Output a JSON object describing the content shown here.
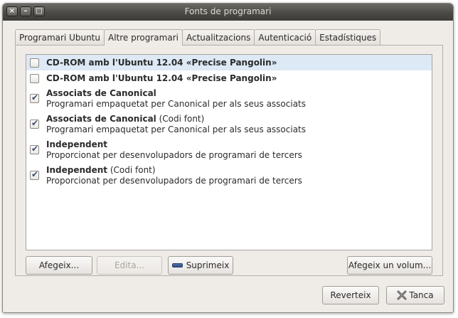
{
  "window": {
    "title": "Fonts de programari",
    "controls": {
      "close": "×",
      "minimize": "–",
      "maximize": "□"
    }
  },
  "tabs": [
    {
      "label": "Programari Ubuntu"
    },
    {
      "label": "Altre programari"
    },
    {
      "label": "Actualitzacions"
    },
    {
      "label": "Autenticació"
    },
    {
      "label": "Estadístiques"
    }
  ],
  "active_tab": "Altre programari",
  "sources": [
    {
      "name": "CD-ROM amb l'Ubuntu 12.04 «Precise Pangolin»",
      "suffix": "",
      "description": "",
      "checked": false,
      "selected": true
    },
    {
      "name": "CD-ROM amb l'Ubuntu 12.04 «Precise Pangolin»",
      "suffix": "",
      "description": "",
      "checked": false,
      "selected": false
    },
    {
      "name": "Associats de Canonical",
      "suffix": "",
      "description": "Programari empaquetat per Canonical per als seus associats",
      "checked": true,
      "selected": false
    },
    {
      "name": "Associats de Canonical",
      "suffix": " (Codi font)",
      "description": "Programari empaquetat per Canonical per als seus associats",
      "checked": true,
      "selected": false
    },
    {
      "name": "Independent",
      "suffix": "",
      "description": "Proporcionat per desenvolupadors de programari de tercers",
      "checked": true,
      "selected": false
    },
    {
      "name": "Independent",
      "suffix": " (Codi font)",
      "description": "Proporcionat per desenvolupadors de programari de tercers",
      "checked": true,
      "selected": false
    }
  ],
  "buttons": {
    "add": "Afegeix...",
    "edit": "Edita...",
    "remove": "Suprimeix",
    "add_volume": "Afegeix un volum...",
    "revert": "Reverteix",
    "cancel": "Tanca"
  },
  "colors": {
    "selection": "#dde9f5",
    "titlebar": "#4b4a46",
    "window_bg": "#efebe7"
  }
}
